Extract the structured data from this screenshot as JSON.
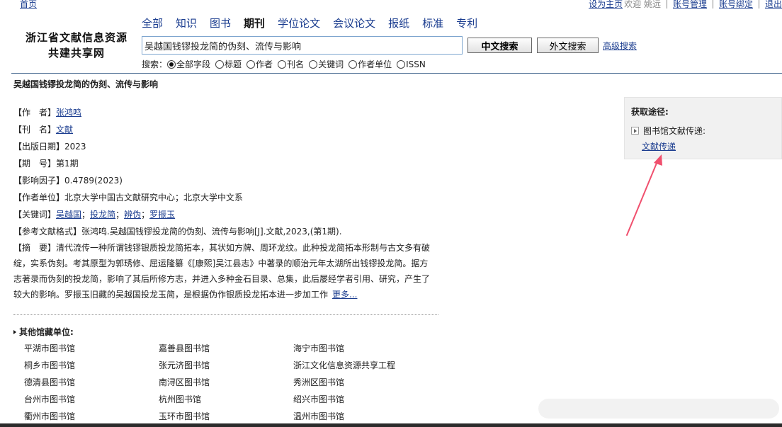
{
  "topbar": {
    "home": "首页",
    "set_home": "设为主页",
    "welcome": "欢迎 姚远",
    "account_manage": "账号管理",
    "account_bind": "账号绑定",
    "logout": "退出"
  },
  "logo": {
    "line1": "浙江省文献信息资源",
    "line2": "共建共享网"
  },
  "nav": {
    "tabs": [
      {
        "label": "全部",
        "active": false
      },
      {
        "label": "知识",
        "active": false
      },
      {
        "label": "图书",
        "active": false
      },
      {
        "label": "期刊",
        "active": true
      },
      {
        "label": "学位论文",
        "active": false
      },
      {
        "label": "会议论文",
        "active": false
      },
      {
        "label": "报纸",
        "active": false
      },
      {
        "label": "标准",
        "active": false
      },
      {
        "label": "专利",
        "active": false
      }
    ]
  },
  "search": {
    "query": "吴越国钱镠投龙简的伪刻、流传与影响",
    "cn_button": "中文搜索",
    "foreign_button": "外文搜索",
    "advanced": "高级搜索",
    "fields_label": "搜索：",
    "fields": [
      {
        "label": "全部字段",
        "checked": true
      },
      {
        "label": "标题",
        "checked": false
      },
      {
        "label": "作者",
        "checked": false
      },
      {
        "label": "刊名",
        "checked": false
      },
      {
        "label": "关键词",
        "checked": false
      },
      {
        "label": "作者单位",
        "checked": false
      },
      {
        "label": "ISSN",
        "checked": false
      }
    ]
  },
  "article": {
    "title": "吴越国钱镠投龙简的伪刻、流传与影响",
    "author_label": "【作　者】",
    "author": "张鸿鸣",
    "journal_label": "【刊　名】",
    "journal": "文献",
    "date_label": "【出版日期】",
    "date": "2023",
    "issue_label": "【期　号】",
    "issue": "第1期",
    "impact_label": "【影响因子】",
    "impact": "0.4789(2023)",
    "affiliation_label": "【作者单位】",
    "affiliation": "北京大学中国古文献研究中心；北京大学中文系",
    "keywords_label": "【关键词】",
    "keywords": [
      "吴越国",
      "投龙简",
      "辨伪",
      "罗振玉"
    ],
    "citation_label": "【参考文献格式】",
    "citation": "张鸿鸣.吴越国钱镠投龙简的伪刻、流传与影响[J].文献,2023,(第1期).",
    "abstract_label": "【摘　要】",
    "abstract": "清代流传一种所谓钱镠银质投龙简拓本，其状如方牌、周环龙纹。此种投龙简拓本形制与古文多有破绽，实系伪刻。考其原型为郭琇修、屈运隆纂《[康熙]吴江县志》中著录的顺治元年太湖所出钱镠投龙简。据方志著录而伪刻的投龙简，影响了其后所修方志，并进入多种金石目录、总集，此后屡经学者引用、研究，产生了较大的影响。罗振玉旧藏的吴越国投龙玉简，是根据伪作银质投龙拓本进一步加工作",
    "more": "更多..."
  },
  "holdings": {
    "title": "其他馆藏单位:",
    "libraries": [
      "平湖市图书馆",
      "嘉善县图书馆",
      "海宁市图书馆",
      "桐乡市图书馆",
      "张元济图书馆",
      "浙江文化信息资源共享工程",
      "德清县图书馆",
      "南浔区图书馆",
      "秀洲区图书馆",
      "台州市图书馆",
      "杭州图书馆",
      "绍兴市图书馆",
      "衢州市图书馆",
      "玉环市图书馆",
      "温州市图书馆"
    ]
  },
  "panel": {
    "title": "获取途径:",
    "item": "图书馆文献传递:",
    "link": "文献传递"
  },
  "colors": {
    "link": "#1a3c8f",
    "rule": "#4d6e94",
    "panel_bg": "#f1f1f1",
    "annotation_arrow": "#f0506e"
  }
}
